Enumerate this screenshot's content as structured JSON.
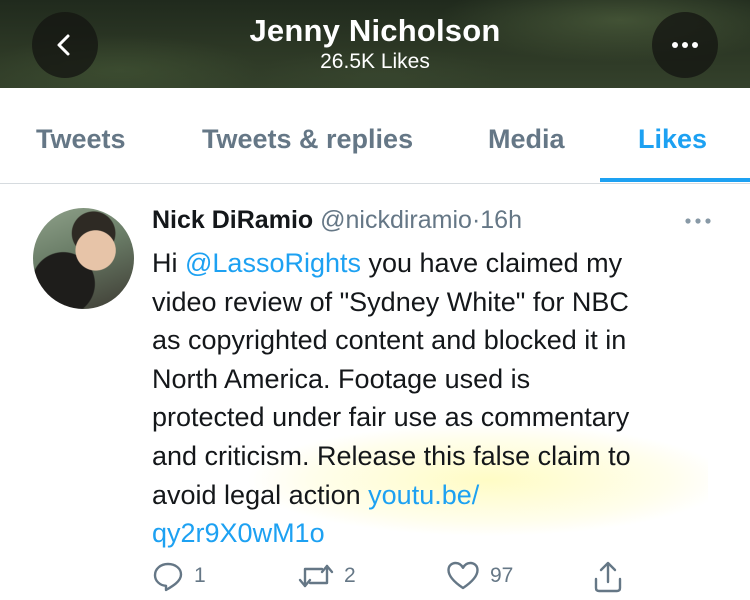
{
  "header": {
    "title": "Jenny Nicholson",
    "subtitle": "26.5K Likes"
  },
  "tabs": [
    {
      "label": "Tweets"
    },
    {
      "label": "Tweets & replies"
    },
    {
      "label": "Media"
    },
    {
      "label": "Likes"
    }
  ],
  "active_tab": "Likes",
  "tweet": {
    "author_name": "Nick DiRamio",
    "handle": "@nickdiramio",
    "separator": "·",
    "time": "16h",
    "text_lines": [
      {
        "pre": "Hi ",
        "link": "@LassoRights",
        "post": " you have claimed my"
      },
      {
        "pre": "video review of \"Sydney White\" for NBC",
        "link": "",
        "post": ""
      },
      {
        "pre": "as copyrighted content and blocked it in",
        "link": "",
        "post": ""
      },
      {
        "pre": "North America. Footage used is",
        "link": "",
        "post": ""
      },
      {
        "pre": "protected under fair use as commentary",
        "link": "",
        "post": ""
      },
      {
        "pre": "and criticism. Release this false claim to",
        "link": "",
        "post": ""
      },
      {
        "pre": "avoid legal action ",
        "link": "youtu.be/",
        "post": ""
      },
      {
        "pre": "",
        "link": "qy2r9X0wM1o",
        "post": ""
      }
    ],
    "replies": "1",
    "retweets": "2",
    "likes": "97"
  },
  "colors": {
    "accent": "#1da1f2",
    "muted": "#657786",
    "text": "#14171a"
  },
  "icons": [
    "chevron-left-icon",
    "more-horizontal-icon",
    "reply-icon",
    "retweet-icon",
    "heart-icon",
    "share-icon"
  ]
}
